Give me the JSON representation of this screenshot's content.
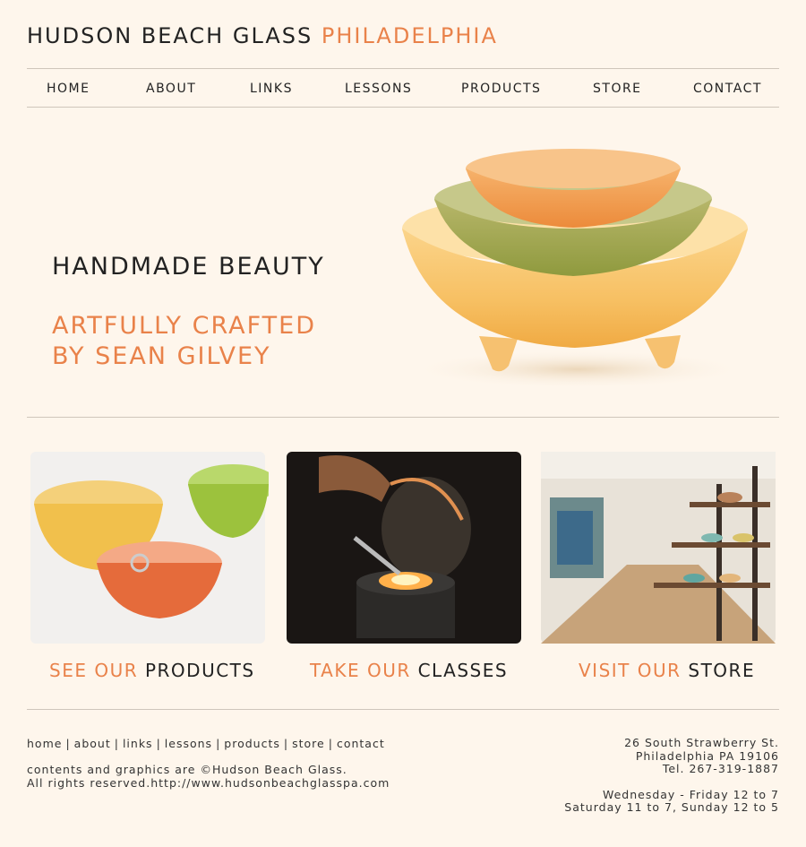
{
  "header": {
    "brand": "HUDSON BEACH GLASS",
    "location": "PHILADELPHIA"
  },
  "nav": {
    "items": [
      "HOME",
      "ABOUT",
      "LINKS",
      "LESSONS",
      "PRODUCTS",
      "STORE",
      "CONTACT"
    ]
  },
  "hero": {
    "title": "HANDMADE BEAUTY",
    "subtitle_line1": "ARTFULLY CRAFTED",
    "subtitle_line2": "BY SEAN GILVEY"
  },
  "features": [
    {
      "lead": "SEE OUR",
      "word": "PRODUCTS"
    },
    {
      "lead": "TAKE OUR",
      "word": "CLASSES"
    },
    {
      "lead": "VISIT OUR",
      "word": "STORE"
    }
  ],
  "footer": {
    "links": [
      "home",
      "about",
      "links",
      "lessons",
      "products",
      "store",
      "contact"
    ],
    "copyright_line1": "contents and graphics are ©Hudson Beach Glass.",
    "copyright_line2": "All rights reserved.http://www.hudsonbeachglasspa.com",
    "address_line1": "26 South Strawberry St.",
    "address_line2": "Philadelphia PA 19106",
    "phone": "Tel. 267-319-1887",
    "hours_line1": "Wednesday - Friday 12 to 7",
    "hours_line2": "Saturday 11 to 7, Sunday 12 to 5"
  },
  "colors": {
    "background": "#fef6ec",
    "accent": "#e9824a",
    "text": "#222222",
    "divider": "#cfc6bb"
  }
}
